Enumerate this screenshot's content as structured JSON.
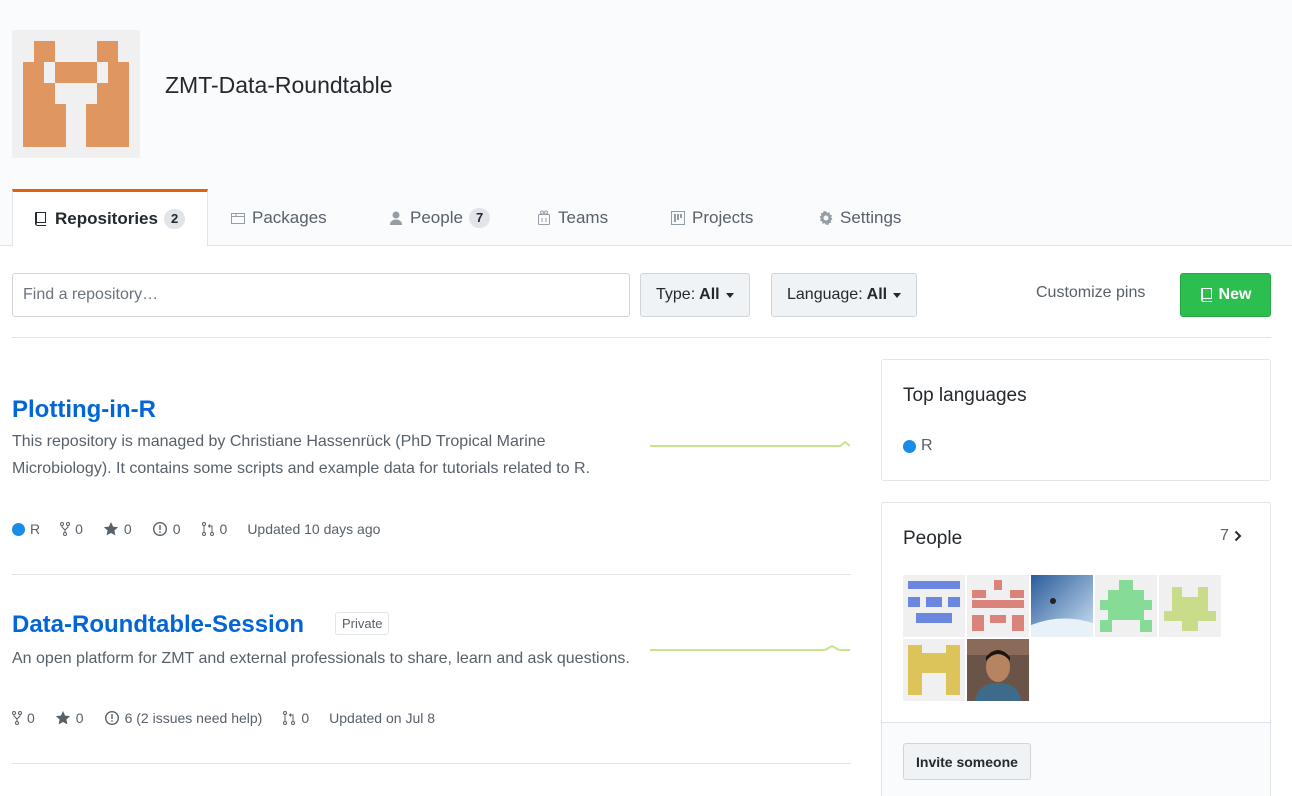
{
  "org": {
    "name": "ZMT-Data-Roundtable",
    "avatar_color": "#e09660"
  },
  "tabs": [
    {
      "label": "Repositories",
      "count": "2",
      "icon": "repo-icon",
      "selected": true
    },
    {
      "label": "Packages",
      "icon": "package-icon"
    },
    {
      "label": "People",
      "count": "7",
      "icon": "person-icon"
    },
    {
      "label": "Teams",
      "icon": "team-icon"
    },
    {
      "label": "Projects",
      "icon": "project-icon"
    },
    {
      "label": "Settings",
      "icon": "gear-icon"
    }
  ],
  "filters": {
    "search_placeholder": "Find a repository…",
    "type_label": "Type:",
    "type_value": "All",
    "language_label": "Language:",
    "language_value": "All",
    "customize_pins": "Customize pins",
    "new_label": "New"
  },
  "repos": [
    {
      "name": "Plotting-in-R",
      "description": "This repository is managed by Christiane Hassenrück (PhD Tropical Marine Microbiology). It contains some scripts and example data for tutorials related to R.",
      "language": "R",
      "language_color": "#198ce7",
      "forks": "0",
      "stars": "0",
      "issues": "0",
      "pulls": "0",
      "updated": "Updated 10 days ago"
    },
    {
      "name": "Data-Roundtable-Session",
      "label": "Private",
      "description": "An open platform for ZMT and external professionals to share, learn and ask questions.",
      "forks": "0",
      "stars": "0",
      "issues": "6 (2 issues need help)",
      "pulls": "0",
      "updated": "Updated on Jul 8"
    }
  ],
  "sidebar": {
    "top_languages": {
      "title": "Top languages",
      "items": [
        {
          "name": "R",
          "color": "#198ce7"
        }
      ]
    },
    "people": {
      "title": "People",
      "count": "7",
      "avatars": [
        {
          "kind": "identicon",
          "color": "#6b87e0"
        },
        {
          "kind": "identicon",
          "color": "#d9837a"
        },
        {
          "kind": "photo"
        },
        {
          "kind": "identicon",
          "color": "#86dc96"
        },
        {
          "kind": "identicon",
          "color": "#c9dc8a"
        },
        {
          "kind": "identicon",
          "color": "#ddc45a"
        },
        {
          "kind": "photo"
        }
      ],
      "invite_label": "Invite someone"
    }
  }
}
